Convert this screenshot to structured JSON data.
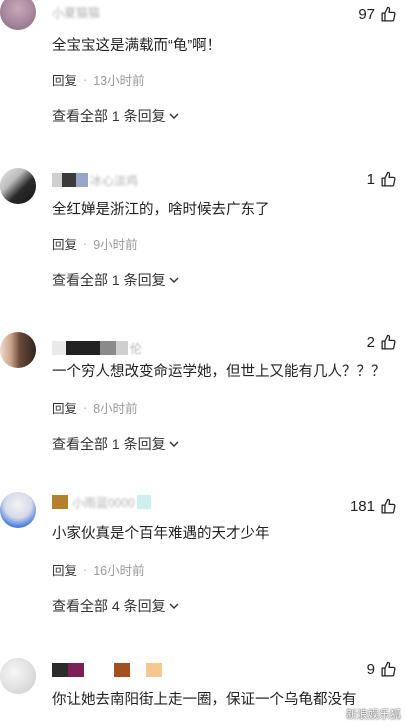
{
  "comments": [
    {
      "username": "小夏猫猫",
      "likes": "97",
      "text": "全宝宝这是满载而“龟”啊！",
      "reply_label": "回复",
      "time": "13小时前",
      "view_all": "查看全部 1 条回复"
    },
    {
      "username": "冰心淡鸡",
      "likes": "1",
      "text": "全红婵是浙江的，啥时候去广东了",
      "reply_label": "回复",
      "time": "9小时前",
      "view_all": "查看全部 1 条回复"
    },
    {
      "username": "伦",
      "likes": "2",
      "text": "一个穷人想改变命运学她，但世上又能有几人？？？",
      "reply_label": "回复",
      "time": "8小时前",
      "view_all": "查看全部 1 条回复"
    },
    {
      "username": "小雨蓝0000",
      "likes": "181",
      "text": "小家伙真是个百年难遇的天才少年",
      "reply_label": "回复",
      "time": "16小时前",
      "view_all": "查看全部 4 条回复"
    },
    {
      "username": "",
      "likes": "9",
      "text": "你让她去南阳街上走一圈，保证一个乌龟都没有"
    }
  ],
  "separator": "·",
  "icons": {
    "like": "thumbs-up-icon",
    "expand": "chevron-down-icon"
  },
  "watermark": "新浪娱乐狐"
}
